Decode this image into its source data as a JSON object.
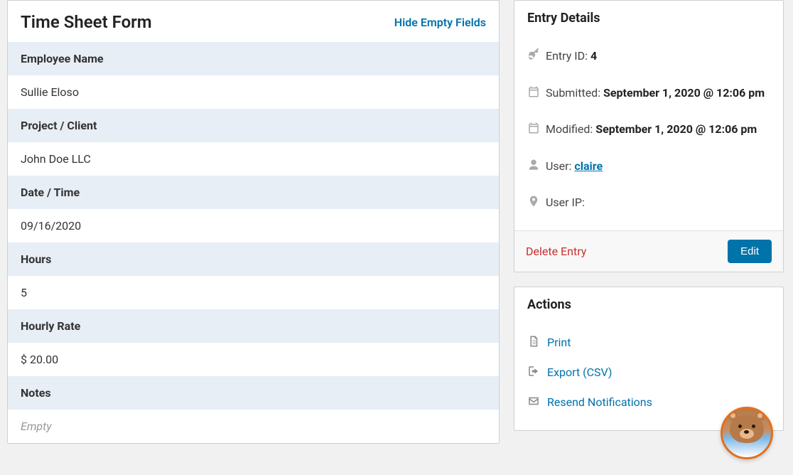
{
  "form": {
    "title": "Time Sheet Form",
    "toggle_label": "Hide Empty Fields",
    "fields": [
      {
        "label": "Employee Name",
        "value": "Sullie Eloso"
      },
      {
        "label": "Project / Client",
        "value": "John Doe LLC"
      },
      {
        "label": "Date / Time",
        "value": "09/16/2020"
      },
      {
        "label": "Hours",
        "value": "5"
      },
      {
        "label": "Hourly Rate",
        "value": "$ 20.00"
      },
      {
        "label": "Notes",
        "value": "Empty",
        "empty": true
      }
    ]
  },
  "details": {
    "title": "Entry Details",
    "entry_id_label": "Entry ID: ",
    "entry_id_value": "4",
    "submitted_label": "Submitted: ",
    "submitted_value": "September 1, 2020 @ 12:06 pm",
    "modified_label": "Modified: ",
    "modified_value": "September 1, 2020 @ 12:06 pm",
    "user_label": "User: ",
    "user_value": "claire",
    "ip_label": "User IP: ",
    "ip_value": " ",
    "delete_label": "Delete Entry",
    "edit_label": "Edit"
  },
  "actions": {
    "title": "Actions",
    "print": "Print",
    "export": "Export (CSV)",
    "resend": "Resend Notifications"
  }
}
